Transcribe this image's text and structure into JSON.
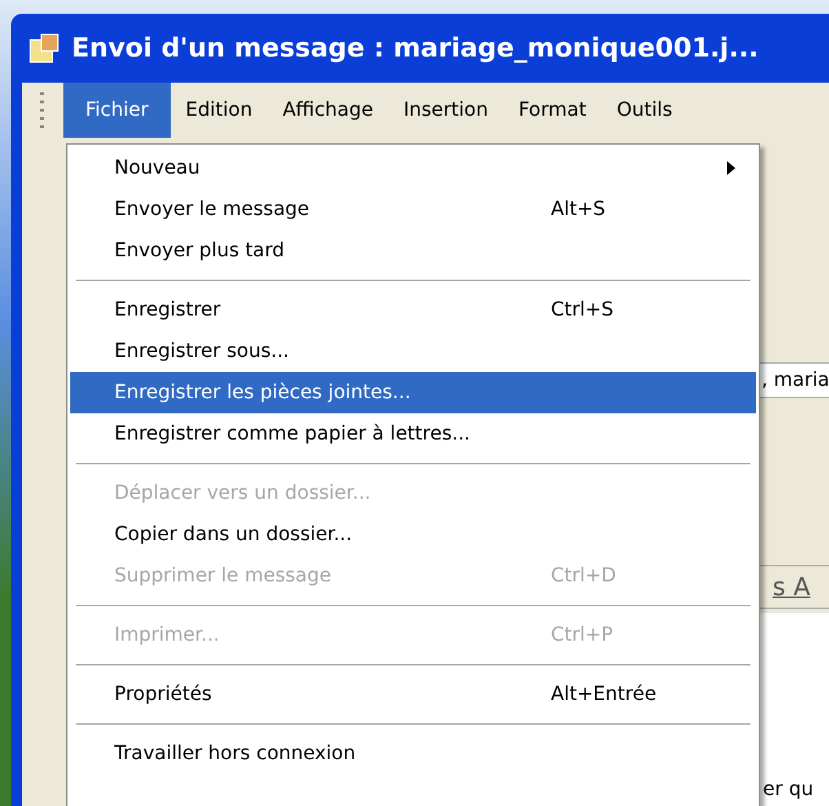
{
  "window": {
    "title": "Envoi d'un message : mariage_monique001.j..."
  },
  "menu_bar": [
    {
      "label": "Fichier",
      "selected": true
    },
    {
      "label": "Edition",
      "selected": false
    },
    {
      "label": "Affichage",
      "selected": false
    },
    {
      "label": "Insertion",
      "selected": false
    },
    {
      "label": "Format",
      "selected": false
    },
    {
      "label": "Outils",
      "selected": false
    }
  ],
  "file_menu": [
    {
      "kind": "item",
      "label": "Nouveau",
      "submenu": true,
      "disabled": false,
      "selected": false
    },
    {
      "kind": "item",
      "label": "Envoyer le message",
      "shortcut": "Alt+S",
      "disabled": false,
      "selected": false
    },
    {
      "kind": "item",
      "label": "Envoyer plus tard",
      "disabled": false,
      "selected": false
    },
    {
      "kind": "separator"
    },
    {
      "kind": "item",
      "label": "Enregistrer",
      "shortcut": "Ctrl+S",
      "disabled": false,
      "selected": false
    },
    {
      "kind": "item",
      "label": "Enregistrer sous...",
      "disabled": false,
      "selected": false
    },
    {
      "kind": "item",
      "label": "Enregistrer les pièces jointes...",
      "disabled": false,
      "selected": true
    },
    {
      "kind": "item",
      "label": "Enregistrer comme papier à lettres...",
      "disabled": false,
      "selected": false
    },
    {
      "kind": "separator"
    },
    {
      "kind": "item",
      "label": "Déplacer vers un dossier...",
      "disabled": true,
      "selected": false
    },
    {
      "kind": "item",
      "label": "Copier dans un dossier...",
      "disabled": false,
      "selected": false
    },
    {
      "kind": "item",
      "label": "Supprimer le message",
      "shortcut": "Ctrl+D",
      "disabled": true,
      "selected": false
    },
    {
      "kind": "separator"
    },
    {
      "kind": "item",
      "label": "Imprimer...",
      "shortcut": "Ctrl+P",
      "disabled": true,
      "selected": false
    },
    {
      "kind": "separator"
    },
    {
      "kind": "item",
      "label": "Propriétés",
      "shortcut": "Alt+Entrée",
      "disabled": false,
      "selected": false
    },
    {
      "kind": "separator"
    },
    {
      "kind": "item",
      "label": "Travailler hors connexion",
      "disabled": false,
      "selected": false
    }
  ],
  "background_text": {
    "attachment_field": ", maria",
    "format_toolbar": "s A",
    "body": "er qu"
  }
}
